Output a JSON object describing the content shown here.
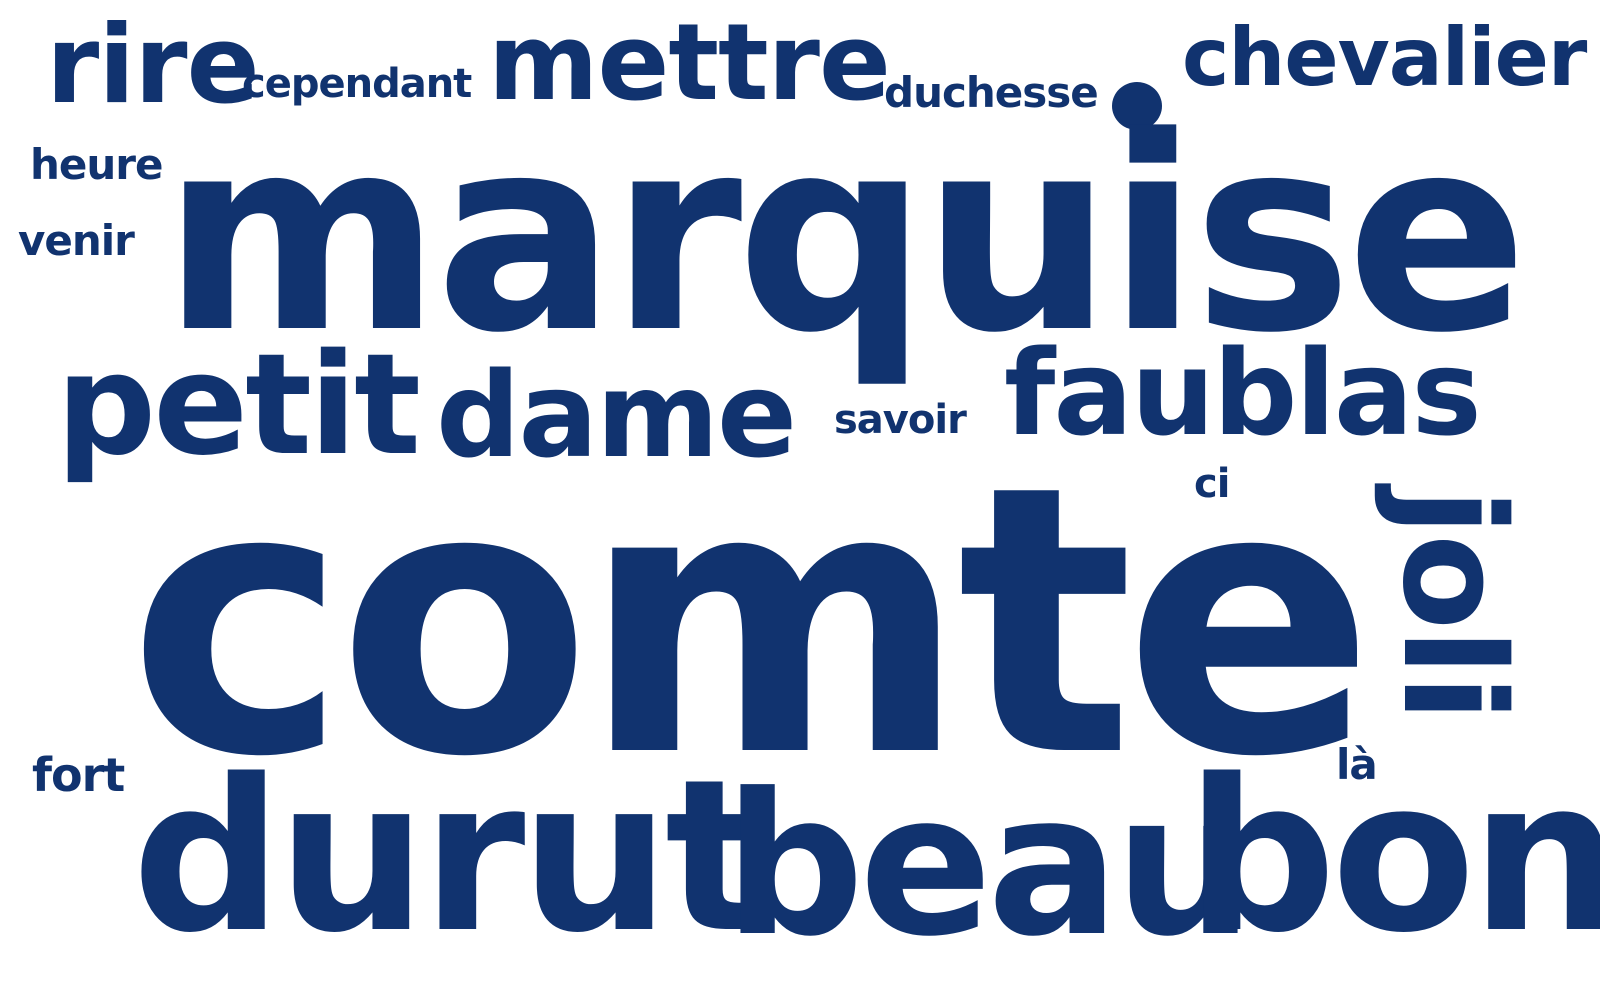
{
  "word_color": "#11336f",
  "background": "#ffffff",
  "words": {
    "rire": "rire",
    "cependant": "cependant",
    "mettre": "mettre",
    "duchesse": "duchesse",
    "chevalier": "chevalier",
    "heure": "heure",
    "venir": "venir",
    "marquise": "marquise",
    "petit": "petit",
    "dame": "dame",
    "savoir": "savoir",
    "faublas": "faublas",
    "ci": "ci",
    "joli": "joli",
    "comte": "comte",
    "fort": "fort",
    "la": "là",
    "durut": "durut",
    "beau": "beau",
    "bon": "bon"
  }
}
